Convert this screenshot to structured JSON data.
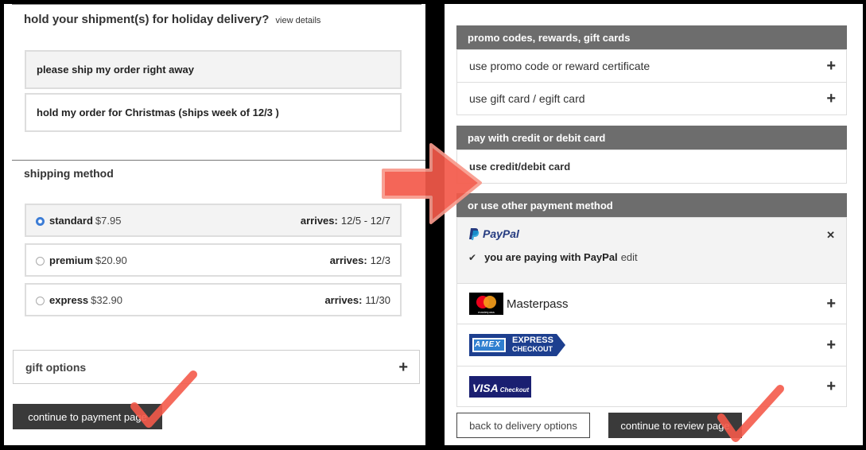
{
  "left": {
    "hold_title": "hold your shipment(s) for holiday delivery?",
    "view_details": "view details",
    "hold_options": [
      "please ship my order right away",
      "hold my order for Christmas (ships week of 12/3 )"
    ],
    "shipping_title": "shipping method",
    "shipping_options": [
      {
        "name": "standard",
        "price": "$7.95",
        "arrives_label": "arrives:",
        "arrives": "12/5 - 12/7",
        "selected": true
      },
      {
        "name": "premium",
        "price": "$20.90",
        "arrives_label": "arrives:",
        "arrives": "12/3",
        "selected": false
      },
      {
        "name": "express",
        "price": "$32.90",
        "arrives_label": "arrives:",
        "arrives": "11/30",
        "selected": false
      }
    ],
    "gift_options": "gift options",
    "continue_button": "continue to payment page"
  },
  "right": {
    "promo_header": "promo codes, rewards, gift cards",
    "promo_rows": [
      "use promo code or reward certificate",
      "use gift card / egift card"
    ],
    "card_header": "pay with credit or debit card",
    "card_row": "use credit/debit card",
    "other_header": "or use other payment method",
    "paypal_logo": "PayPal",
    "paypal_status": "you are paying with PayPal",
    "paypal_edit": "edit",
    "masterpass_label": "Masterpass",
    "masterpass_small": "masterpass",
    "amex_top": "EXPRESS",
    "amex_bottom": "CHECKOUT",
    "amex_badge": "AMEX",
    "visa_main": "VISA",
    "visa_sub": "Checkout",
    "back_button": "back to delivery options",
    "review_button": "continue to review page"
  },
  "icons": {
    "plus": "+",
    "close": "✕",
    "check": "✔"
  },
  "colors": {
    "header_gray": "#6d6d6d",
    "dark_button": "#3a3a3a",
    "radio_blue": "#3a7bd5",
    "paypal_blue": "#253b80",
    "paypal_light": "#179bd7",
    "amex_blue": "#1d3f8f",
    "visa_navy": "#1a1f71",
    "arrow_red": "#f45a4a"
  }
}
